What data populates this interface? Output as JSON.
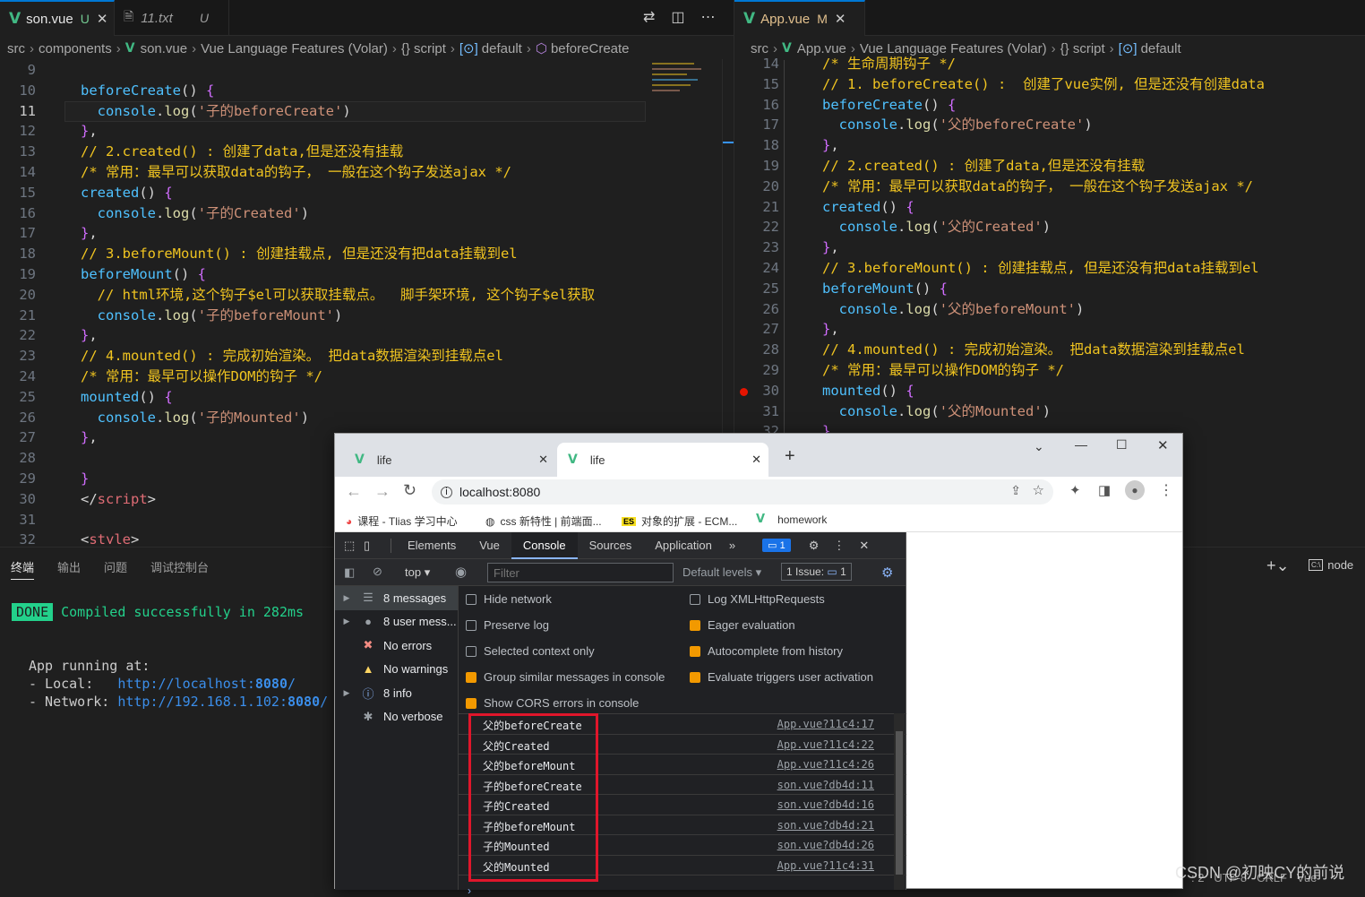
{
  "left_editor": {
    "tabs": [
      {
        "name": "son.vue",
        "status": "U",
        "active": true
      },
      {
        "name": "11.txt",
        "status": "U",
        "active": false
      }
    ],
    "breadcrumb": [
      "src",
      "components",
      "son.vue",
      "Vue Language Features (Volar)",
      "{} script",
      "default",
      "beforeCreate"
    ],
    "lines": [
      {
        "n": "9",
        "parts": []
      },
      {
        "n": "10",
        "parts": [
          [
            "f",
            "beforeCreate"
          ],
          [
            "t",
            "() "
          ],
          [
            "p",
            "{"
          ]
        ]
      },
      {
        "n": "11",
        "parts": [
          [
            "t",
            "  "
          ],
          [
            "m",
            "console"
          ],
          [
            "t",
            "."
          ],
          [
            "k",
            "log"
          ],
          [
            "t",
            "("
          ],
          [
            "s",
            "'子的beforeCreate'"
          ],
          [
            "t",
            ")"
          ]
        ]
      },
      {
        "n": "12",
        "parts": [
          [
            "p",
            "}"
          ],
          [
            "t",
            ","
          ]
        ]
      },
      {
        "n": "13",
        "parts": [
          [
            "cm",
            "// 2.created() : 创建了data,但是还没有挂载"
          ]
        ]
      },
      {
        "n": "14",
        "parts": [
          [
            "cm",
            "/* 常用：最早可以获取data的钩子， 一般在这个钩子发送ajax */"
          ]
        ]
      },
      {
        "n": "15",
        "parts": [
          [
            "f",
            "created"
          ],
          [
            "t",
            "() "
          ],
          [
            "p",
            "{"
          ]
        ]
      },
      {
        "n": "16",
        "parts": [
          [
            "t",
            "  "
          ],
          [
            "m",
            "console"
          ],
          [
            "t",
            "."
          ],
          [
            "k",
            "log"
          ],
          [
            "t",
            "("
          ],
          [
            "s",
            "'子的Created'"
          ],
          [
            "t",
            ")"
          ]
        ]
      },
      {
        "n": "17",
        "parts": [
          [
            "p",
            "}"
          ],
          [
            "t",
            ","
          ]
        ]
      },
      {
        "n": "18",
        "parts": [
          [
            "cm",
            "// 3.beforeMount() : 创建挂载点, 但是还没有把data挂载到el"
          ]
        ]
      },
      {
        "n": "19",
        "parts": [
          [
            "f",
            "beforeMount"
          ],
          [
            "t",
            "() "
          ],
          [
            "p",
            "{"
          ]
        ]
      },
      {
        "n": "20",
        "parts": [
          [
            "t",
            "  "
          ],
          [
            "cm",
            "// html环境,这个钩子$el可以获取挂载点。  脚手架环境, 这个钩子$el获取"
          ]
        ]
      },
      {
        "n": "21",
        "parts": [
          [
            "t",
            "  "
          ],
          [
            "m",
            "console"
          ],
          [
            "t",
            "."
          ],
          [
            "k",
            "log"
          ],
          [
            "t",
            "("
          ],
          [
            "s",
            "'子的beforeMount'"
          ],
          [
            "t",
            ")"
          ]
        ]
      },
      {
        "n": "22",
        "parts": [
          [
            "p",
            "}"
          ],
          [
            "t",
            ","
          ]
        ]
      },
      {
        "n": "23",
        "parts": [
          [
            "cm",
            "// 4.mounted() : 完成初始渲染。 把data数据渲染到挂载点el"
          ]
        ]
      },
      {
        "n": "24",
        "parts": [
          [
            "cm",
            "/* 常用：最早可以操作DOM的钩子 */"
          ]
        ]
      },
      {
        "n": "25",
        "parts": [
          [
            "f",
            "mounted"
          ],
          [
            "t",
            "() "
          ],
          [
            "p",
            "{"
          ]
        ]
      },
      {
        "n": "26",
        "parts": [
          [
            "t",
            "  "
          ],
          [
            "m",
            "console"
          ],
          [
            "t",
            "."
          ],
          [
            "k",
            "log"
          ],
          [
            "t",
            "("
          ],
          [
            "s",
            "'子的Mounted'"
          ],
          [
            "t",
            ")"
          ]
        ]
      },
      {
        "n": "27",
        "parts": [
          [
            "p",
            "}"
          ],
          [
            "t",
            ","
          ]
        ]
      },
      {
        "n": "28",
        "parts": []
      },
      {
        "n": "29",
        "parts": [
          [
            "p",
            "}"
          ]
        ]
      },
      {
        "n": "30",
        "parts": [
          [
            "t",
            "</"
          ],
          [
            "tag",
            "script"
          ],
          [
            "t",
            ">"
          ]
        ]
      },
      {
        "n": "31",
        "parts": []
      },
      {
        "n": "32",
        "parts": [
          [
            "t",
            "<"
          ],
          [
            "tag",
            "style"
          ],
          [
            "t",
            ">"
          ]
        ]
      }
    ]
  },
  "right_editor": {
    "tabs": [
      {
        "name": "App.vue",
        "status": "M",
        "active": true
      }
    ],
    "breadcrumb": [
      "src",
      "App.vue",
      "Vue Language Features (Volar)",
      "{} script",
      "default"
    ],
    "lines": [
      {
        "n": "14",
        "parts": [
          [
            "cm",
            "/* 生命周期钩子 */"
          ]
        ]
      },
      {
        "n": "15",
        "parts": [
          [
            "cm",
            "// 1. beforeCreate() :  创建了vue实例, 但是还没有创建data"
          ]
        ]
      },
      {
        "n": "16",
        "parts": [
          [
            "f",
            "beforeCreate"
          ],
          [
            "t",
            "() "
          ],
          [
            "p",
            "{"
          ]
        ]
      },
      {
        "n": "17",
        "parts": [
          [
            "t",
            "  "
          ],
          [
            "m",
            "console"
          ],
          [
            "t",
            "."
          ],
          [
            "k",
            "log"
          ],
          [
            "t",
            "("
          ],
          [
            "s",
            "'父的beforeCreate'"
          ],
          [
            "t",
            ")"
          ]
        ]
      },
      {
        "n": "18",
        "parts": [
          [
            "p",
            "}"
          ],
          [
            "t",
            ","
          ]
        ]
      },
      {
        "n": "19",
        "parts": [
          [
            "cm",
            "// 2.created() : 创建了data,但是还没有挂载"
          ]
        ]
      },
      {
        "n": "20",
        "parts": [
          [
            "cm",
            "/* 常用：最早可以获取data的钩子， 一般在这个钩子发送ajax */"
          ]
        ]
      },
      {
        "n": "21",
        "parts": [
          [
            "f",
            "created"
          ],
          [
            "t",
            "() "
          ],
          [
            "p",
            "{"
          ]
        ]
      },
      {
        "n": "22",
        "parts": [
          [
            "t",
            "  "
          ],
          [
            "m",
            "console"
          ],
          [
            "t",
            "."
          ],
          [
            "k",
            "log"
          ],
          [
            "t",
            "("
          ],
          [
            "s",
            "'父的Created'"
          ],
          [
            "t",
            ")"
          ]
        ]
      },
      {
        "n": "23",
        "parts": [
          [
            "p",
            "}"
          ],
          [
            "t",
            ","
          ]
        ]
      },
      {
        "n": "24",
        "parts": [
          [
            "cm",
            "// 3.beforeMount() : 创建挂载点, 但是还没有把data挂载到el"
          ]
        ]
      },
      {
        "n": "25",
        "parts": [
          [
            "f",
            "beforeMount"
          ],
          [
            "t",
            "() "
          ],
          [
            "p",
            "{"
          ]
        ]
      },
      {
        "n": "26",
        "parts": [
          [
            "t",
            "  "
          ],
          [
            "m",
            "console"
          ],
          [
            "t",
            "."
          ],
          [
            "k",
            "log"
          ],
          [
            "t",
            "("
          ],
          [
            "s",
            "'父的beforeMount'"
          ],
          [
            "t",
            ")"
          ]
        ]
      },
      {
        "n": "27",
        "parts": [
          [
            "p",
            "}"
          ],
          [
            "t",
            ","
          ]
        ]
      },
      {
        "n": "28",
        "parts": [
          [
            "cm",
            "// 4.mounted() : 完成初始渲染。 把data数据渲染到挂载点el"
          ]
        ]
      },
      {
        "n": "29",
        "parts": [
          [
            "cm",
            "/* 常用：最早可以操作DOM的钩子 */"
          ]
        ]
      },
      {
        "n": "30",
        "parts": [
          [
            "f",
            "mounted"
          ],
          [
            "t",
            "() "
          ],
          [
            "p",
            "{"
          ]
        ]
      },
      {
        "n": "31",
        "parts": [
          [
            "t",
            "  "
          ],
          [
            "m",
            "console"
          ],
          [
            "t",
            "."
          ],
          [
            "k",
            "log"
          ],
          [
            "t",
            "("
          ],
          [
            "s",
            "'父的Mounted'"
          ],
          [
            "t",
            ")"
          ]
        ]
      },
      {
        "n": "32",
        "parts": [
          [
            "p",
            "}"
          ],
          [
            "t",
            ","
          ]
        ]
      }
    ]
  },
  "terminal": {
    "tabs": [
      "终端",
      "输出",
      "问题",
      "调试控制台"
    ],
    "done_badge": "DONE",
    "compiled": "Compiled successfully in 282ms",
    "app_running": "App running at:",
    "local_label": "- Local:   ",
    "local_url": "http://localhost:",
    "local_port": "8080",
    "network_label": "- Network: ",
    "network_url": "http://192.168.1.102:",
    "network_port": "8080",
    "shell": "node"
  },
  "browser": {
    "tabs": [
      {
        "title": "life"
      },
      {
        "title": "life"
      }
    ],
    "url": "localhost:8080",
    "bookmarks": [
      "课程 - Tlias 学习中心",
      "css 新特性 | 前端面...",
      "对象的扩展 - ECM...",
      "homework"
    ],
    "devtools": {
      "tabs": [
        "Elements",
        "Vue",
        "Console",
        "Sources",
        "Application"
      ],
      "issue_count": "1",
      "context": "top",
      "filter_placeholder": "Filter",
      "levels": "Default levels",
      "issues_label": "1 Issue:",
      "issues_count": "1",
      "sidebar": [
        {
          "label": "8 messages",
          "icon": "list-icon"
        },
        {
          "label": "8 user mess...",
          "icon": "user-icon"
        },
        {
          "label": "No errors",
          "icon": "error-icon"
        },
        {
          "label": "No warnings",
          "icon": "warning-icon"
        },
        {
          "label": "8 info",
          "icon": "info-icon"
        },
        {
          "label": "No verbose",
          "icon": "verbose-icon"
        }
      ],
      "settings_left": [
        {
          "label": "Hide network",
          "checked": false
        },
        {
          "label": "Preserve log",
          "checked": false
        },
        {
          "label": "Selected context only",
          "checked": false
        },
        {
          "label": "Group similar messages in console",
          "checked": true
        },
        {
          "label": "Show CORS errors in console",
          "checked": true
        }
      ],
      "settings_right": [
        {
          "label": "Log XMLHttpRequests",
          "checked": false
        },
        {
          "label": "Eager evaluation",
          "checked": true
        },
        {
          "label": "Autocomplete from history",
          "checked": true
        },
        {
          "label": "Evaluate triggers user activation",
          "checked": true
        }
      ],
      "logs": [
        {
          "msg": "父的beforeCreate",
          "src": "App.vue?11c4:17"
        },
        {
          "msg": "父的Created",
          "src": "App.vue?11c4:22"
        },
        {
          "msg": "父的beforeMount",
          "src": "App.vue?11c4:26"
        },
        {
          "msg": "子的beforeCreate",
          "src": "son.vue?db4d:11"
        },
        {
          "msg": "子的Created",
          "src": "son.vue?db4d:16"
        },
        {
          "msg": "子的beforeMount",
          "src": "son.vue?db4d:21"
        },
        {
          "msg": "子的Mounted",
          "src": "son.vue?db4d:26"
        },
        {
          "msg": "父的Mounted",
          "src": "App.vue?11c4:31"
        }
      ]
    }
  },
  "watermark": "CSDN @初映CY的前说"
}
